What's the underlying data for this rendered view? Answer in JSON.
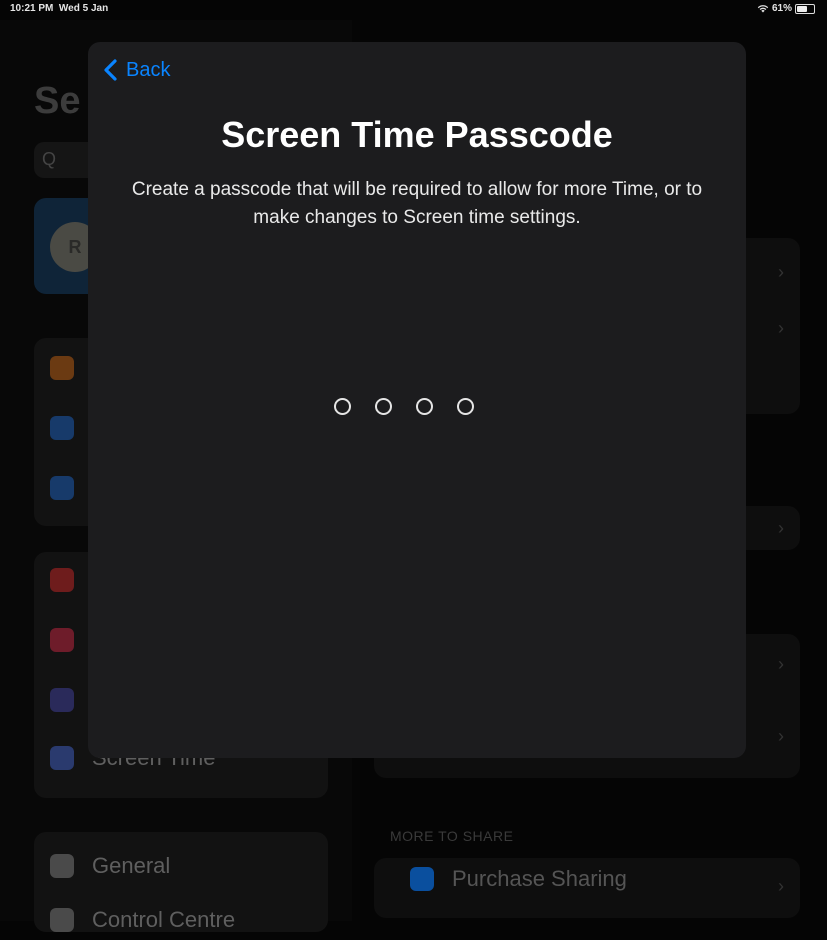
{
  "status_bar": {
    "time": "10:21 PM",
    "date": "Wed 5 Jan",
    "battery": "61%",
    "battery_level": 0.61
  },
  "background": {
    "sidebar_title": "Se",
    "search_glyph": "Q",
    "avatar_initials": "R",
    "sidebar_items": [
      {
        "label": "Screen Time",
        "icon": "hourglass-icon",
        "color": "#2a3a6e"
      },
      {
        "label": "General",
        "icon": "gear-icon",
        "color": "#4a4a4a"
      },
      {
        "label": "Control Centre",
        "icon": "control-centre-icon",
        "color": "#4a4a4a"
      }
    ],
    "section_header": "MORE TO SHARE",
    "main_item": {
      "label": "Purchase Sharing",
      "icon": "app-store-icon",
      "color": "#0a63c9"
    }
  },
  "modal": {
    "back_label": "Back",
    "title": "Screen Time Passcode",
    "description": "Create a passcode that will be required to allow for more Time, or to make changes to Screen time settings.",
    "passcode_length": 4,
    "accent_color": "#0a84ff"
  }
}
